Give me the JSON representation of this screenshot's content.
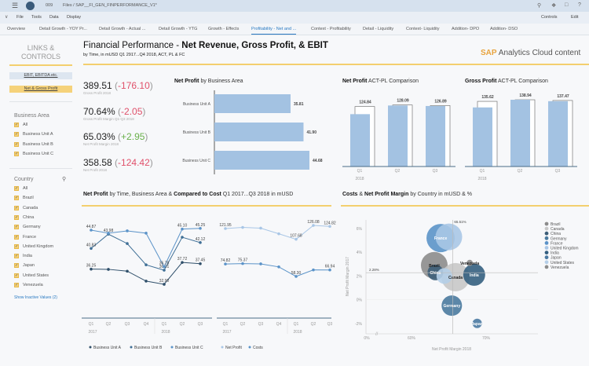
{
  "shell": {
    "menu_icon": "hamburger-icon",
    "user_icon": "user-icon",
    "workspace": "009",
    "breadcrumb": "Files / SAP__FI_GEN_FINPERFORMANCE_V1*",
    "right_icons": [
      "search-icon",
      "megaphone-icon",
      "chat-icon",
      "help-icon"
    ]
  },
  "menu": {
    "items": [
      "File",
      "Tools",
      "Data",
      "Display"
    ],
    "controls": "Controls",
    "edit": "Edit"
  },
  "tabs": [
    "Overview",
    "Detail Growth - YOY Pr...",
    "Detail Growth - Actual ...",
    "Detail Growth - YTG",
    "Growth - Effects",
    "Profitability - Net and ...",
    "Context - Profitability",
    "Detail - Liquidity",
    "Context- Liquidity",
    "Addition- DPO",
    "Addition- DSO"
  ],
  "active_tab": 5,
  "sidebar": {
    "title": "LINKS & CONTROLS",
    "buttons": [
      "EBIT, EBITDA etc.",
      "Net & Gross Profit"
    ],
    "business_area": {
      "label": "Business Area",
      "items": [
        "All",
        "Business Unit A",
        "Business Unit B",
        "Business Unit C"
      ]
    },
    "country": {
      "label": "Country",
      "items": [
        "All",
        "Brazil",
        "Canada",
        "China",
        "Germany",
        "France",
        "United Kingdom",
        "India",
        "Japan",
        "United States",
        "Venezuela"
      ]
    },
    "show_inactive": "Show Inactive Values (2)"
  },
  "page": {
    "title_pre": "Financial Performance - ",
    "title_bold": "Net Revenue, Gross Profit, & EBIT",
    "subtitle": "by Time, in mUSD Q1 2917...Q4 2018, ACT, PL & FC",
    "brand_sap": "SAP",
    "brand_rest": " Analytics Cloud content"
  },
  "kpis": [
    {
      "value": "389.51",
      "delta": "-176.10",
      "label": "Gross Profit 2018",
      "color": "#e0506a"
    },
    {
      "value": "70.64%",
      "delta": "-2.05",
      "label": "Gross Profit Margin Q1-Q3 2018",
      "color": "#e0506a"
    },
    {
      "value": "65.03%",
      "delta": "+2.95",
      "label": "Net Profit Margin 2018",
      "color": "#6ab04c"
    },
    {
      "value": "358.58",
      "delta": "-124.42",
      "label": "Net Profit 2018",
      "color": "#e0506a"
    }
  ],
  "chart_data": [
    {
      "id": "np-by-ba",
      "type": "bar",
      "title_bold": "Net Profit",
      "title_rest": " by Business Area",
      "categories": [
        "Business Unit A",
        "Business Unit B",
        "Business Unit C"
      ],
      "values": [
        35.81,
        41.9,
        44.68
      ],
      "labels": [
        "35.81",
        "41.90",
        "44.68"
      ],
      "xlim": [
        0,
        50
      ]
    },
    {
      "id": "np-actpl",
      "type": "bar",
      "title_bold": "Net Profit",
      "title_rest": " ACT-PL Comparison",
      "categories": [
        "Q1",
        "Q2",
        "Q3"
      ],
      "year": "2018",
      "series": [
        {
          "name": "Actual",
          "values": [
            109,
            127,
            126
          ]
        },
        {
          "name": "Plan",
          "values": [
            124.84,
            128.09,
            126.89
          ],
          "labels": [
            "124.84",
            "128.09",
            "126.89"
          ]
        }
      ],
      "ylim": [
        0,
        160
      ]
    },
    {
      "id": "gp-actpl",
      "type": "bar",
      "title_bold": "Gross Profit",
      "title_rest": " ACT-PL Comparison",
      "categories": [
        "Q1",
        "Q2",
        "Q3"
      ],
      "year": "2018",
      "series": [
        {
          "name": "Actual",
          "values": [
            123,
            139,
            136
          ]
        },
        {
          "name": "Plan",
          "values": [
            135.62,
            138.94,
            137.47
          ],
          "labels": [
            "135.62",
            "138.94",
            "137.47"
          ]
        }
      ],
      "ylim": [
        0,
        160
      ]
    },
    {
      "id": "np-time",
      "type": "line",
      "title_bold1": "Net Profit",
      "title_mid": " by Time, Business Area & ",
      "title_bold2": "Compared to Cost",
      "title_rest": " Q1 2017...Q3 2018 in mUSD",
      "x": [
        "Q1",
        "Q2",
        "Q3",
        "Q4",
        "Q1",
        "Q2",
        "Q3"
      ],
      "years": [
        "2017",
        "2018"
      ],
      "panels": [
        {
          "series": [
            {
              "name": "Business Unit A",
              "color": "#2f4f6a",
              "values": [
                36.25,
                36.2,
                35.8,
                33.6,
                32.9,
                37.72,
                37.45
              ],
              "labels": [
                "36.25",
                "",
                "",
                "",
                "32.90",
                "37.72",
                "37.45"
              ]
            },
            {
              "name": "Business Unit B",
              "color": "#3f6f96",
              "values": [
                40.83,
                43.98,
                41.9,
                37.2,
                36.01,
                43.3,
                42.12
              ],
              "labels": [
                "40.83",
                "43.98",
                "",
                "",
                "36.01",
                "",
                "42.12"
              ]
            },
            {
              "name": "Business Unit C",
              "color": "#5b93c8",
              "values": [
                44.87,
                44.2,
                44.7,
                44.2,
                36.78,
                45.1,
                45.25
              ],
              "labels": [
                "44.87",
                "",
                "",
                "",
                "36.78",
                "45.10",
                "45.25"
              ]
            }
          ],
          "ylim": [
            25,
            50
          ]
        },
        {
          "series": [
            {
              "name": "Net Profit",
              "color": "#a8c6e6",
              "values": [
                121.95,
                123.5,
                122.5,
                115,
                107.68,
                126.08,
                124.82
              ],
              "labels": [
                "121.95",
                "",
                "",
                "",
                "107.68",
                "126.08",
                "124.82"
              ]
            },
            {
              "name": "Costs",
              "color": "#5b93c8",
              "values": [
                74.82,
                75.37,
                75,
                71,
                58.3,
                67,
                66.94
              ],
              "labels": [
                "74.82",
                "75.37",
                "",
                "",
                "58.30",
                "",
                "66.94"
              ]
            }
          ],
          "ylim": [
            20,
            135
          ]
        }
      ]
    },
    {
      "id": "costs-npm",
      "type": "scatter",
      "title_bold1": "Costs",
      "title_mid1": " & ",
      "title_bold2": "Net Profit Margin",
      "title_mid2": " by Country",
      "title_rest": " in mUSD & %",
      "xlabel": "Net Profit Margin 2018",
      "ylabel": "Net Profit Margin 2017",
      "xticks": [
        "0%",
        "60%",
        "70%"
      ],
      "yticks": [
        "6%",
        "4%",
        "2%",
        "0%",
        "-2%"
      ],
      "xlim": [
        57,
        75
      ],
      "ylim": [
        -3,
        7
      ],
      "ref_x": {
        "value": 65.51,
        "label": "65.51%"
      },
      "ref_y": {
        "value": 2.28,
        "label": "2.28%"
      },
      "points": [
        {
          "name": "Brazil",
          "x": 63.05,
          "y": 2.9,
          "size": 17,
          "color": "#8c8c8c"
        },
        {
          "name": "Canada",
          "x": 65.9,
          "y": 1.9,
          "size": 18,
          "color": "#c8c8c8"
        },
        {
          "name": "China",
          "x": 63.2,
          "y": 2.3,
          "size": 10,
          "color": "#3d5e78"
        },
        {
          "name": "Germany",
          "x": 65.4,
          "y": -0.5,
          "size": 13,
          "color": "#4a7a9e"
        },
        {
          "name": "France",
          "x": 63.9,
          "y": 5.2,
          "size": 18,
          "color": "#5b93c8"
        },
        {
          "name": "United Kingdom",
          "x": 65.0,
          "y": 5.3,
          "size": 17,
          "color": "#a8c6e6"
        },
        {
          "name": "India",
          "x": 68.4,
          "y": 2.1,
          "size": 14,
          "color": "#345f80"
        },
        {
          "name": "Japan",
          "x": 68.8,
          "y": -2.0,
          "size": 6,
          "color": "#4b7aa2"
        },
        {
          "name": "United States",
          "x": 64.4,
          "y": 2.0,
          "size": 10,
          "color": "#b5cfe8"
        },
        {
          "name": "Venezuela",
          "x": 67.8,
          "y": 3.1,
          "size": 4,
          "color": "#8c8c8c"
        }
      ]
    }
  ]
}
